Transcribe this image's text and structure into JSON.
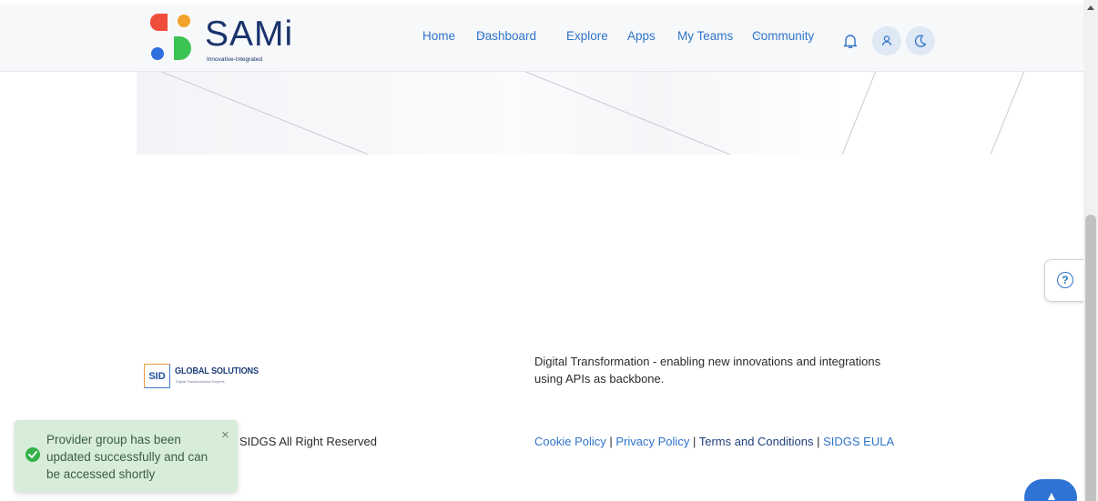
{
  "header": {
    "brand_name": "SAMi",
    "brand_tagline": "Innovative-Integrated",
    "nav": [
      {
        "label": "Home",
        "has_dropdown": false
      },
      {
        "label": "Dashboard",
        "has_dropdown": true
      },
      {
        "label": "Explore",
        "has_dropdown": false
      },
      {
        "label": "Apps",
        "has_dropdown": false
      },
      {
        "label": "My Teams",
        "has_dropdown": false
      },
      {
        "label": "Community",
        "has_dropdown": true
      }
    ],
    "icons": [
      "bell-icon",
      "user-icon",
      "moon-icon"
    ]
  },
  "footer": {
    "company_logo_text": "SID",
    "company_name": "GLOBAL SOLUTIONS",
    "company_sub": "Digital Transformation Experts",
    "tagline": "Digital Transformation - enabling new innovations and integrations using APIs as backbone.",
    "copyright": "SIDGS All Right Reserved",
    "links": [
      "Cookie Policy",
      "Privacy Policy",
      "Terms and Conditions",
      "SIDGS EULA"
    ],
    "separator": "|"
  },
  "toast": {
    "message": "Provider group has been updated successfully and can be accessed shortly",
    "close": "×",
    "status": "success",
    "color": "#36b24a"
  },
  "help": {
    "icon": "question-icon",
    "glyph": "?"
  },
  "scroll_top": {
    "icon": "arrow-up-icon",
    "glyph": "▲"
  },
  "colors": {
    "accent": "#2f74c8",
    "brand_navy": "#19336b"
  }
}
